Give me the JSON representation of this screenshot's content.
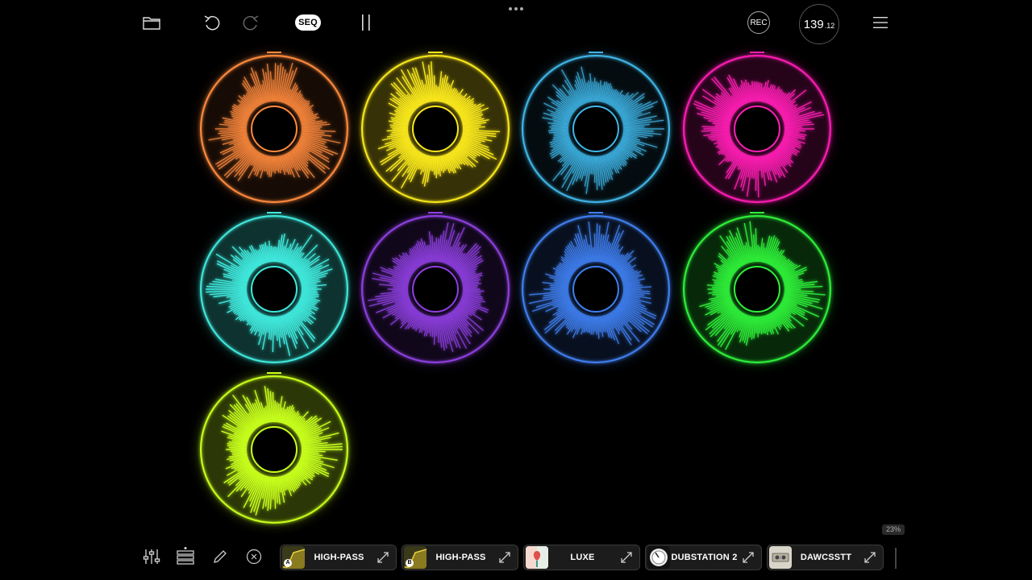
{
  "toolbar": {
    "seq_label": "SEQ",
    "rec_label": "REC",
    "bpm_main": "139",
    "bpm_decimal": ".12"
  },
  "colors": {
    "background": "#000000",
    "pads": [
      "#ff8a3d",
      "#f8e71c",
      "#3fb6e8",
      "#ff1fb4",
      "#3fe8dc",
      "#8e3fe0",
      "#3f7ff0",
      "#2ef03a",
      "#c8ff1c"
    ]
  },
  "pads": [
    {
      "color": "#ff8a3d",
      "intensity": 0.55
    },
    {
      "color": "#f8e71c",
      "intensity": 1.0
    },
    {
      "color": "#3fb6e8",
      "intensity": 0.45
    },
    {
      "color": "#ff1fb4",
      "intensity": 0.75
    },
    {
      "color": "#3fe8dc",
      "intensity": 1.0
    },
    {
      "color": "#8e3fe0",
      "intensity": 0.65
    },
    {
      "color": "#3f7ff0",
      "intensity": 0.7
    },
    {
      "color": "#2ef03a",
      "intensity": 0.85
    },
    {
      "color": "#c8ff1c",
      "intensity": 1.0
    }
  ],
  "bottom": {
    "cpu_percent": "23%",
    "slots": [
      {
        "label": "HIGH-PASS",
        "badge": "A",
        "thumb": "filter"
      },
      {
        "label": "HIGH-PASS",
        "badge": "B",
        "thumb": "filter"
      },
      {
        "label": "LUXE",
        "badge": "",
        "thumb": "luxe"
      },
      {
        "label": "DUBSTATION 2",
        "badge": "",
        "thumb": "knob"
      },
      {
        "label": "DAWCSSTT",
        "badge": "",
        "thumb": "tape"
      }
    ]
  }
}
